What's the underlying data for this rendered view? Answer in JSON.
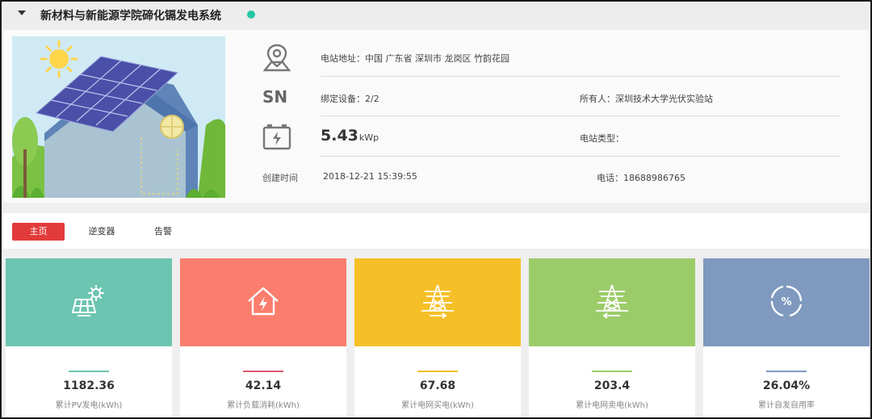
{
  "header": {
    "title": "新材料与新能源学院碲化镉发电系统",
    "status_color": "#26c6a4"
  },
  "info": {
    "address_label": "电站地址：",
    "address": "中国 广东省 深圳市 龙岗区 竹韵花园",
    "bound_devices_label": "绑定设备：",
    "bound_devices": "2/2",
    "owner_label": "所有人：",
    "owner": "深圳技术大学光伏实验站",
    "capacity_value": "5.43",
    "capacity_unit": "kWp",
    "station_type_label": "电站类型：",
    "station_type": "",
    "created_label": "创建时间",
    "created": "2018-12-21 15:39:55",
    "phone_label": "电话：",
    "phone": "18688986765",
    "sn_icon_text": "SN"
  },
  "icons": {
    "location": "location-pin-icon",
    "sn": "sn-icon",
    "battery": "battery-icon"
  },
  "tabs": [
    {
      "label": "主页",
      "active": true
    },
    {
      "label": "逆变器",
      "active": false
    },
    {
      "label": "告警",
      "active": false
    }
  ],
  "cards": [
    {
      "value": "1182.36",
      "label": "累计PV发电(kWh)",
      "color": "#6cc5b0",
      "bar_color": "#6cc5b0",
      "icon": "solar-panel-icon"
    },
    {
      "value": "42.14",
      "label": "累计负载消耗(kWh)",
      "color": "#fb7d6d",
      "bar_color": "#d9566a",
      "icon": "house-power-icon"
    },
    {
      "value": "67.68",
      "label": "累计电网买电(kWh)",
      "color": "#f5bf27",
      "bar_color": "#f5bf27",
      "icon": "grid-buy-icon"
    },
    {
      "value": "203.4",
      "label": "累计电网卖电(kWh)",
      "color": "#9ccc6a",
      "bar_color": "#9ccc6a",
      "icon": "grid-sell-icon"
    },
    {
      "value": "26.04%",
      "label": "累计自发自用率",
      "color": "#7f99bf",
      "bar_color": "#7f99bf",
      "icon": "percent-icon"
    }
  ]
}
